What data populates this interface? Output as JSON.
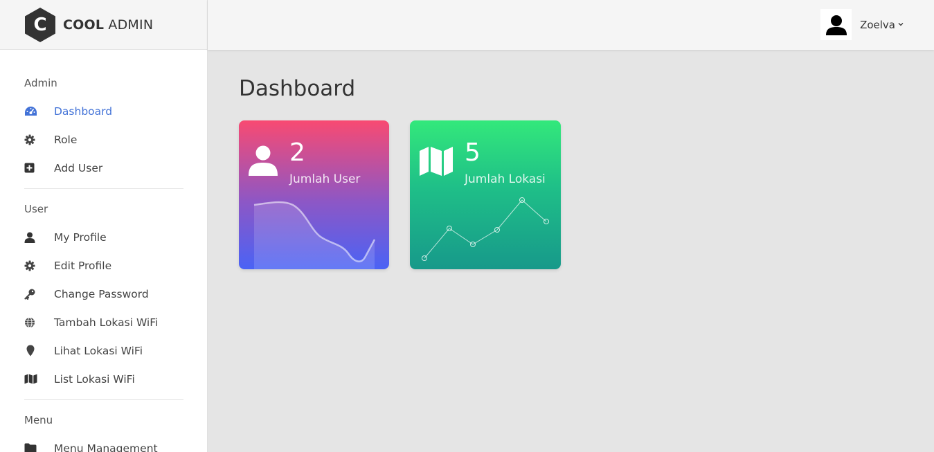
{
  "brand": {
    "logo_letter": "C",
    "name_bold": "COOL",
    "name_regular": "ADMIN"
  },
  "header": {
    "user_name": "Zoelva"
  },
  "sidebar": {
    "sections": [
      {
        "heading": "Admin",
        "items": [
          {
            "label": "Dashboard",
            "icon": "tachometer-icon",
            "active": true
          },
          {
            "label": "Role",
            "icon": "gear-icon"
          },
          {
            "label": "Add User",
            "icon": "plus-square-icon"
          }
        ]
      },
      {
        "heading": "User",
        "items": [
          {
            "label": "My Profile",
            "icon": "user-icon"
          },
          {
            "label": "Edit Profile",
            "icon": "gear-icon"
          },
          {
            "label": "Change Password",
            "icon": "key-icon"
          },
          {
            "label": "Tambah Lokasi WiFi",
            "icon": "globe-icon"
          },
          {
            "label": "Lihat Lokasi WiFi",
            "icon": "map-marker-icon"
          },
          {
            "label": "List Lokasi WiFi",
            "icon": "map-icon"
          }
        ]
      },
      {
        "heading": "Menu",
        "items": [
          {
            "label": "Menu Management",
            "icon": "folder-icon"
          }
        ]
      }
    ]
  },
  "main": {
    "title": "Dashboard",
    "cards": [
      {
        "value": "2",
        "label": "Jumlah User",
        "icon": "user-icon"
      },
      {
        "value": "5",
        "label": "Jumlah Lokasi",
        "icon": "map-icon"
      }
    ]
  },
  "colors": {
    "accent": "#4272d7",
    "card_users_top": "#f84a72",
    "card_users_bottom": "#4a63f5",
    "card_loc_top": "#33e87b",
    "card_loc_bottom": "#17998a"
  }
}
